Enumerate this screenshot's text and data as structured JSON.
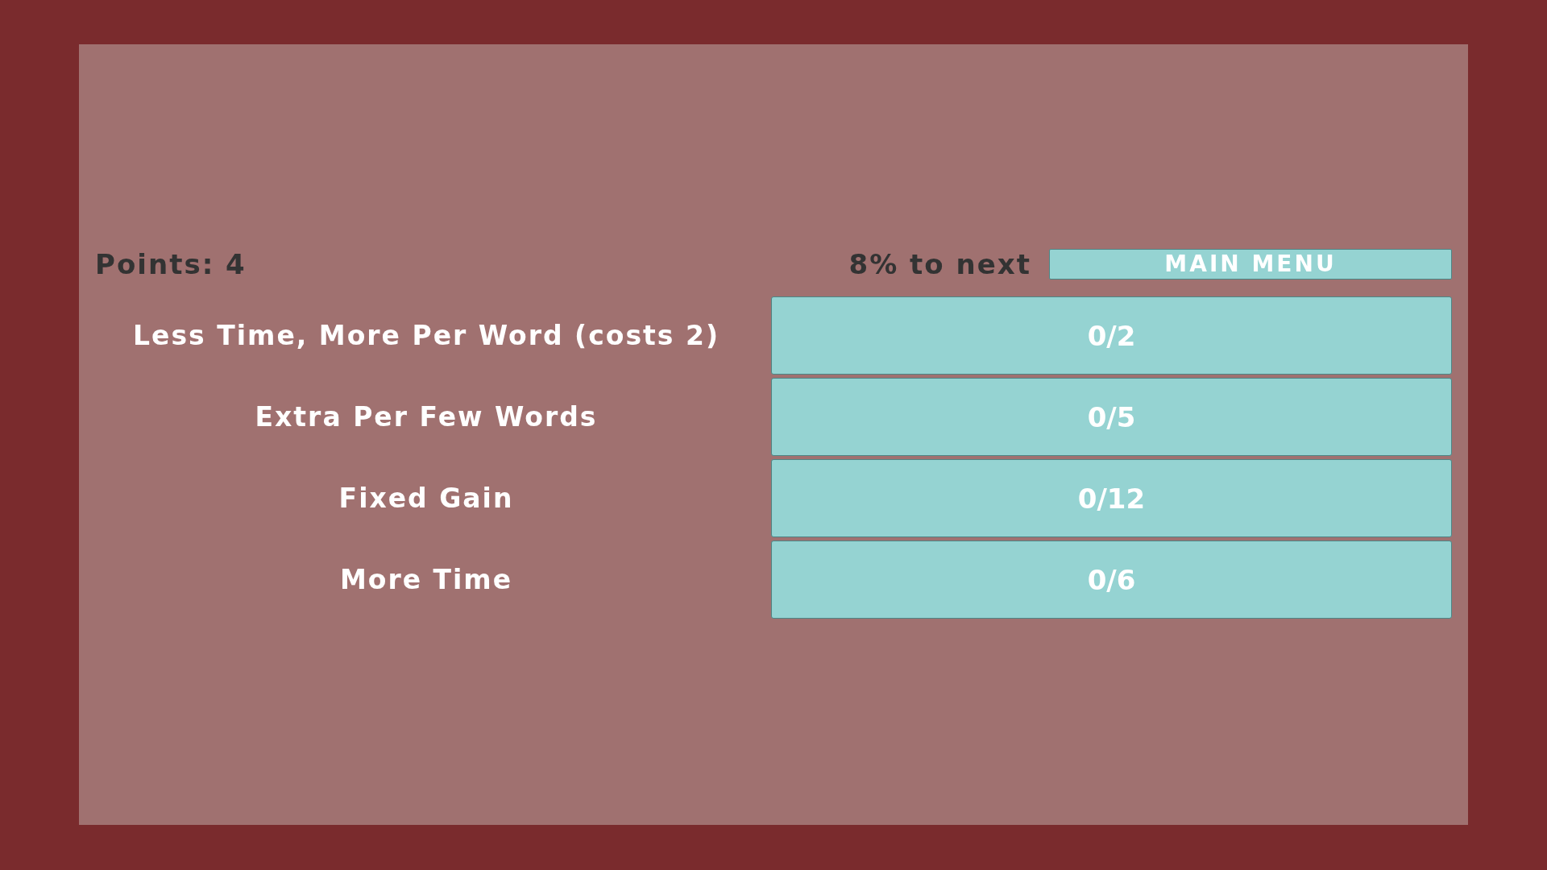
{
  "header": {
    "points": "Points: 4",
    "progress": "8% to next",
    "main_menu_button": "MAIN MENU"
  },
  "upgrades": [
    {
      "name": "Less Time, More Per Word (costs 2)",
      "value": "0/2"
    },
    {
      "name": "Extra Per Few Words",
      "value": "0/5"
    },
    {
      "name": "Fixed Gain",
      "value": "0/12"
    },
    {
      "name": "More Time",
      "value": "0/6"
    }
  ]
}
